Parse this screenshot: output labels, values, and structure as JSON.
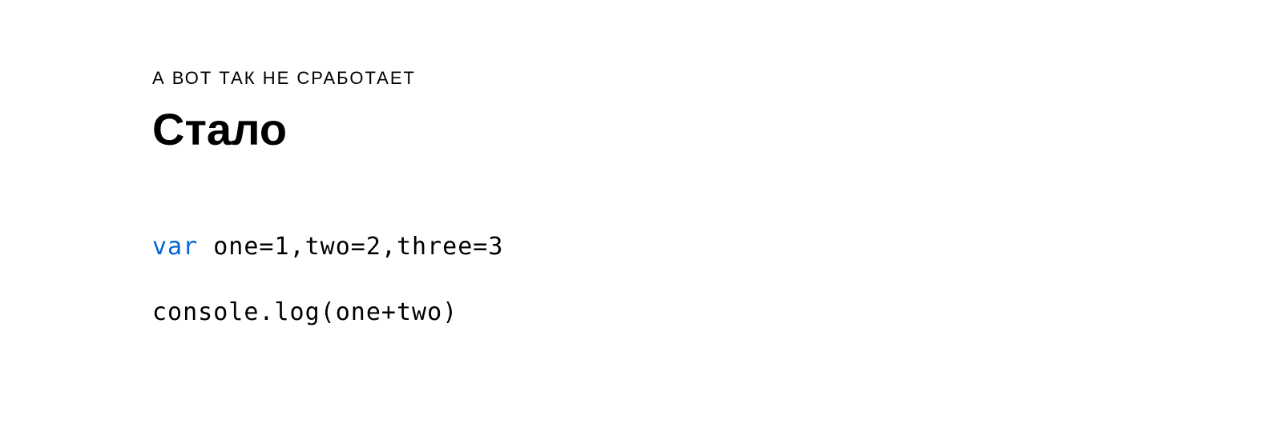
{
  "overline": "А ВОТ ТАК НЕ СРАБОТАЕТ",
  "heading": "Стало",
  "code": {
    "line1_keyword": "var",
    "line1_rest": " one=1,two=2,three=3",
    "line2": "console.log(one+two)"
  }
}
